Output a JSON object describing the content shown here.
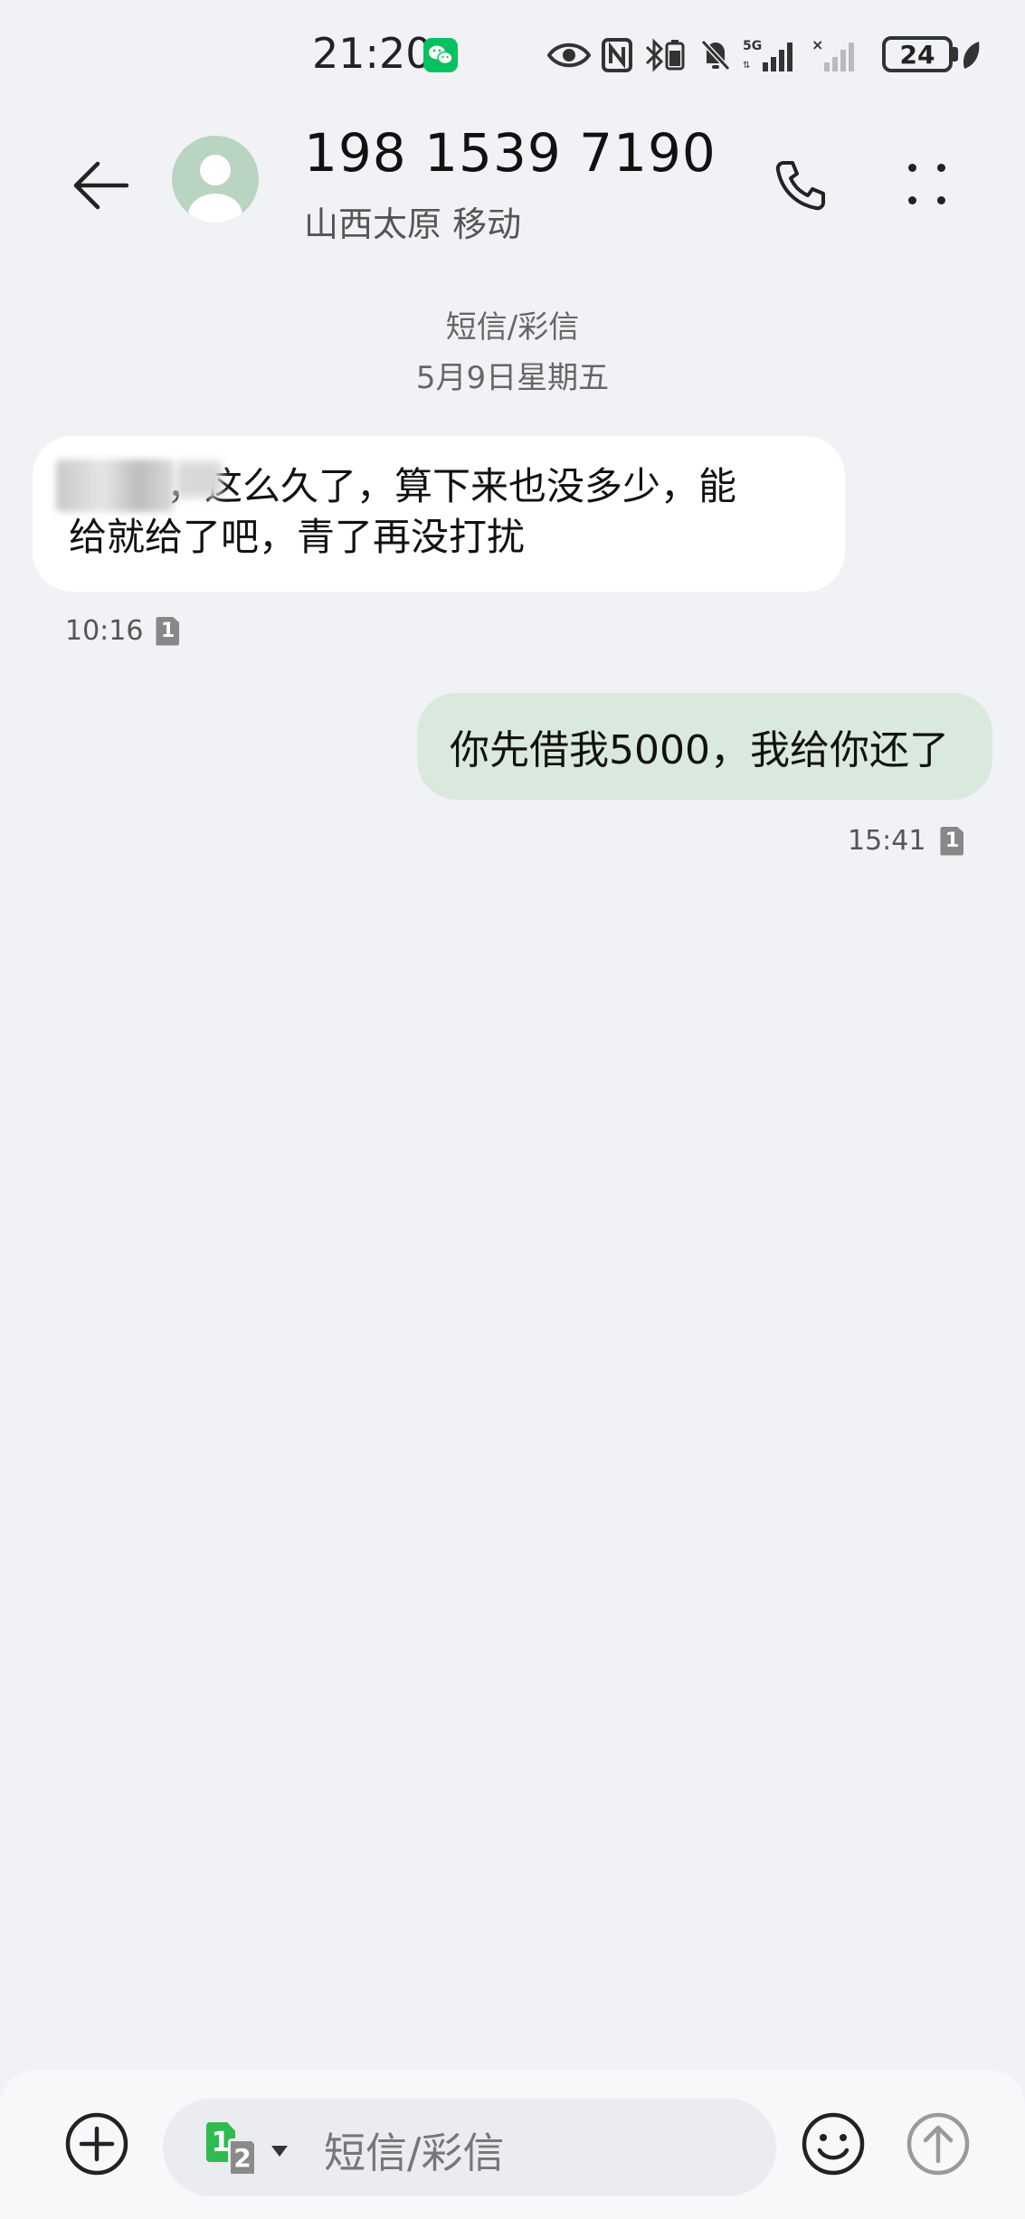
{
  "status_bar": {
    "time": "21:20",
    "network": "5G",
    "battery": "24",
    "icons": [
      "wechat-icon",
      "eye-icon",
      "nfc-icon",
      "bluetooth-battery-icon",
      "mute-bell-icon",
      "signal-5g-icon",
      "signal-no-service-icon",
      "battery-icon",
      "leaf-icon"
    ]
  },
  "header": {
    "contact_number": "198 1539 7190",
    "contact_location": "山西太原 移动",
    "icons": [
      "back-arrow-icon",
      "avatar-person-icon",
      "phone-icon",
      "more-dots-icon"
    ]
  },
  "thread": {
    "message_type": "短信/彩信",
    "date": "5月9日星期五",
    "messages": [
      {
        "direction": "incoming",
        "text_line1": "，这么久了，算下来也没多少，能",
        "text_line2": "给就给了吧，青了再没打扰",
        "time": "10:16",
        "sim": "1"
      },
      {
        "direction": "outgoing",
        "text": "你先借我5000，我给你还了",
        "time": "15:41",
        "sim": "1"
      }
    ]
  },
  "composer": {
    "placeholder": "短信/彩信",
    "sim_primary": "1",
    "sim_secondary": "2",
    "icons": [
      "add-circle-icon",
      "sim-switch-icon",
      "emoji-icon",
      "send-arrow-icon"
    ]
  },
  "colors": {
    "background": "#f0f2f5",
    "incoming_bubble": "#ffffff",
    "outgoing_bubble": "#dae9dd",
    "sim1_green": "#2fbb4f",
    "wechat_green": "#07c160"
  }
}
